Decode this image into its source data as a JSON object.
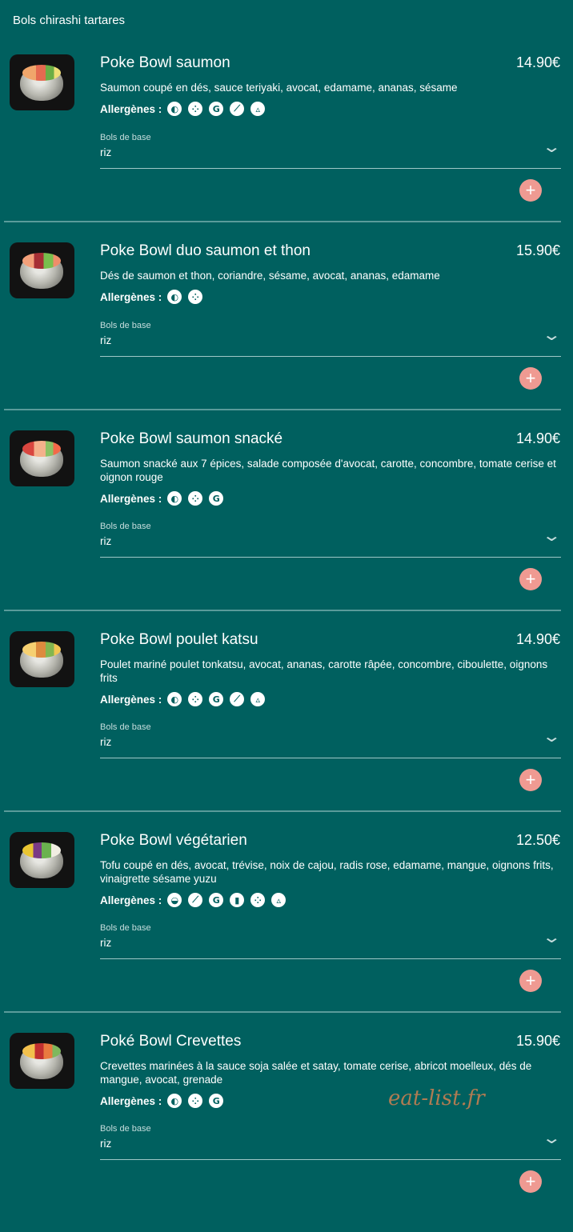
{
  "section_title": "Bols chirashi tartares",
  "watermark": "eat-list.fr",
  "allergens_label": "Allergènes :",
  "base_label": "Bols de base",
  "items": [
    {
      "name": "Poke Bowl saumon",
      "price": "14.90€",
      "description": "Saumon coupé en dés, sauce teriyaki, avocat, edamame, ananas, sésame",
      "allergens": [
        "fish-icon",
        "sesame-icon",
        "gluten-icon",
        "peanut-icon",
        "mustard-icon"
      ],
      "base_value": "riz"
    },
    {
      "name": "Poke Bowl duo saumon et thon",
      "price": "15.90€",
      "description": "Dés de saumon et thon, coriandre, sésame, avocat, ananas, edamame",
      "allergens": [
        "fish-icon",
        "sesame-icon"
      ],
      "base_value": "riz"
    },
    {
      "name": "Poke Bowl saumon snacké",
      "price": "14.90€",
      "description": "Saumon snacké aux 7 épices, salade composée d'avocat, carotte, concombre, tomate cerise et oignon rouge",
      "allergens": [
        "fish-icon",
        "sesame-icon",
        "gluten-icon"
      ],
      "base_value": "riz"
    },
    {
      "name": "Poke Bowl poulet katsu",
      "price": "14.90€",
      "description": "Poulet mariné poulet tonkatsu, avocat, ananas, carotte râpée, concombre, ciboulette, oignons frits",
      "allergens": [
        "fish-icon",
        "sesame-icon",
        "gluten-icon",
        "peanut-icon",
        "mustard-icon"
      ],
      "base_value": "riz"
    },
    {
      "name": "Poke Bowl végétarien",
      "price": "12.50€",
      "description": "Tofu coupé en dés, avocat, trévise, noix de cajou, radis rose, edamame, mangue, oignons frits, vinaigrette sésame yuzu",
      "allergens": [
        "nuts-icon",
        "peanut-icon",
        "gluten-icon",
        "soy-icon",
        "sesame-icon",
        "mustard-icon"
      ],
      "base_value": "riz"
    },
    {
      "name": "Poké Bowl Crevettes",
      "price": "15.90€",
      "description": "Crevettes marinées à la sauce soja salée et satay, tomate cerise, abricot moelleux, dés de mangue, avocat, grenade",
      "allergens": [
        "fish-icon",
        "sesame-icon",
        "gluten-icon"
      ],
      "base_value": "riz"
    }
  ]
}
